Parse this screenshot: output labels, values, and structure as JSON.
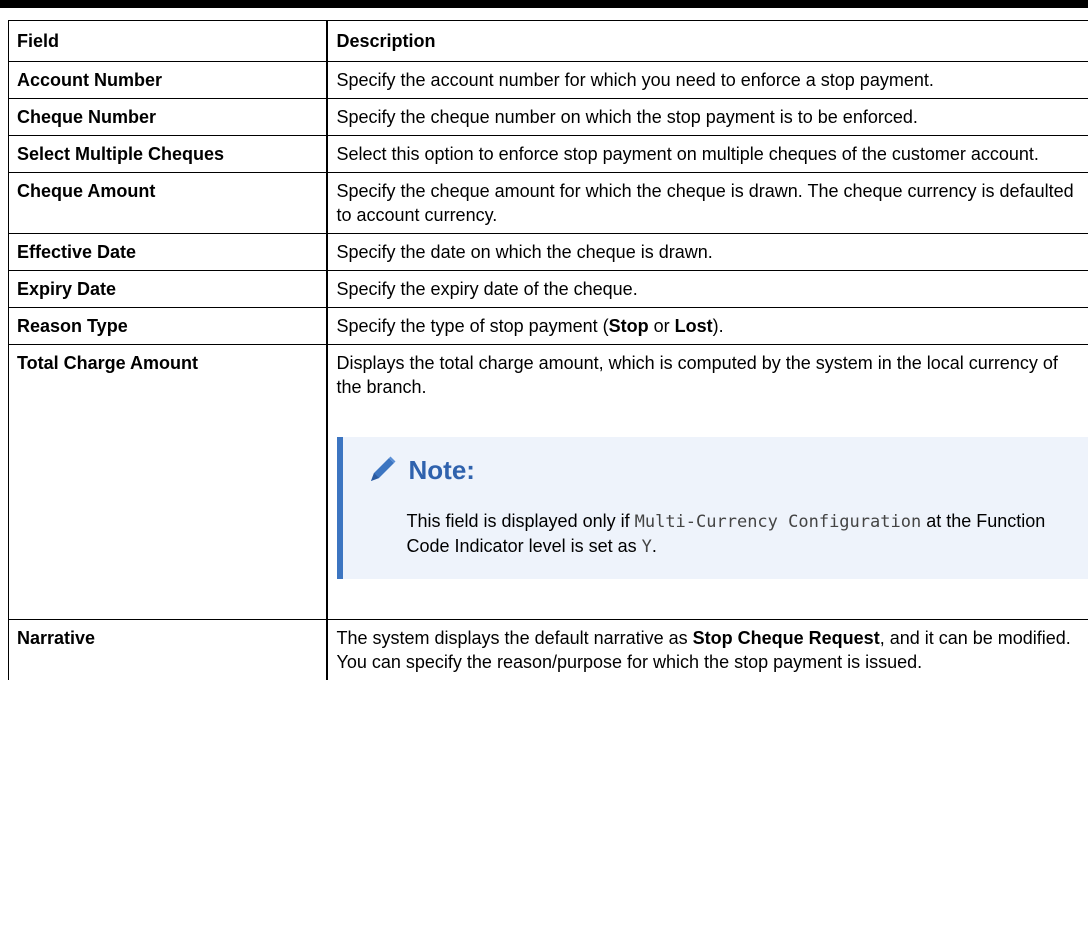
{
  "table": {
    "headers": {
      "field": "Field",
      "description": "Description"
    },
    "rows": [
      {
        "field": "Account Number",
        "description": "Specify the account number for which you need to enforce a stop payment."
      },
      {
        "field": "Cheque Number",
        "description": "Specify the cheque number on which the stop payment is to be enforced."
      },
      {
        "field": "Select Multiple Cheques",
        "description": "Select this option to enforce stop payment on multiple cheques of the customer account."
      },
      {
        "field": "Cheque Amount",
        "description": "Specify the cheque amount for which the cheque is drawn. The cheque currency is defaulted to account currency."
      },
      {
        "field": "Effective Date",
        "description": "Specify the date on which the cheque is drawn."
      },
      {
        "field": "Expiry Date",
        "description": "Specify the expiry date of the cheque."
      },
      {
        "field": "Reason Type",
        "description_pre": "Specify the type of stop payment (",
        "description_bold1": "Stop",
        "description_mid": " or ",
        "description_bold2": "Lost",
        "description_post": ")."
      },
      {
        "field": "Total Charge Amount",
        "description": "Displays the total charge amount, which is computed by the system in the local currency of the branch.",
        "note": {
          "title": "Note:",
          "text_pre": "This field is displayed only if ",
          "code1": "Multi-Currency Configuration",
          "text_mid": " at the Function Code Indicator level is set as ",
          "code2": "Y",
          "text_post": "."
        }
      },
      {
        "field": "Narrative",
        "description_pre": "The system displays the default narrative as ",
        "description_bold": "Stop Cheque Request",
        "description_post": ", and it can be modified. You can specify the reason/purpose for which the stop payment is issued."
      }
    ]
  },
  "icons": {
    "note_icon": "pencil-icon"
  },
  "colors": {
    "note_accent": "#3c75c1",
    "note_background": "#eef3fb",
    "note_title": "#2f62ad"
  }
}
